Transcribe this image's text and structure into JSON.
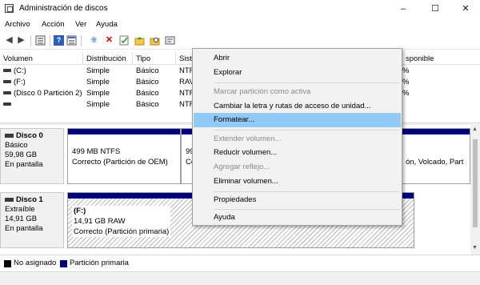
{
  "window": {
    "title": "Administración de discos"
  },
  "menu": [
    "Archivo",
    "Acción",
    "Ver",
    "Ayuda"
  ],
  "toolbar": {
    "icons": [
      "back-icon",
      "forward-icon",
      "list-view-icon",
      "help-icon",
      "details-icon",
      "connect-icon",
      "delete-icon",
      "check-icon",
      "folder-up-icon",
      "folder-search-icon",
      "properties-icon"
    ]
  },
  "grid": {
    "headers": {
      "volumen": "Volumen",
      "distribucion": "Distribución",
      "tipo": "Tipo",
      "sist": "Sist",
      "disponible": "sponible"
    },
    "rows": [
      {
        "volumen": "(C:)",
        "distribucion": "Simple",
        "tipo": "Básico",
        "sist": "NTF",
        "pct": "%"
      },
      {
        "volumen": "(F:)",
        "distribucion": "Simple",
        "tipo": "Básico",
        "sist": "RAV",
        "pct": "%"
      },
      {
        "volumen": "(Disco 0 Partición 2)",
        "distribucion": "Simple",
        "tipo": "Básico",
        "sist": "NTF",
        "pct": "%"
      },
      {
        "volumen": "",
        "distribucion": "Simple",
        "tipo": "Básico",
        "sist": "NTF",
        "pct": ""
      }
    ]
  },
  "disks": [
    {
      "name": "Disco 0",
      "type": "Básico",
      "size": "59,98 GB",
      "status": "En pantalla",
      "p1": {
        "line1": "499 MB NTFS",
        "line2": "Correcto (Partición de OEM)"
      },
      "p2": {
        "line1": "99",
        "line2": "Co"
      },
      "p3": {
        "line2": "ón, Volcado, Part"
      }
    },
    {
      "name": "Disco 1",
      "type": "Extraíble",
      "size": "14,91 GB",
      "status": "En pantalla",
      "p1": {
        "line0": "(F:)",
        "line1": "14,91 GB RAW",
        "line2": "Correcto (Partición primaria)"
      }
    }
  ],
  "legend": {
    "unassigned": "No asignado",
    "primary": "Partición primaria",
    "unassigned_color": "#000000",
    "primary_color": "#00007f"
  },
  "context_menu": {
    "items": {
      "abrir": "Abrir",
      "explorar": "Explorar",
      "marcar": "Marcar partición como activa",
      "cambiar": "Cambiar la letra y rutas de acceso de unidad...",
      "formatear": "Formatear...",
      "extender": "Extender volumen...",
      "reducir": "Reducir volumen...",
      "agregar": "Agregar reflejo...",
      "eliminar": "Eliminar volumen...",
      "propiedades": "Propiedades",
      "ayuda": "Ayuda"
    },
    "highlight_color": "#91c9f7"
  }
}
